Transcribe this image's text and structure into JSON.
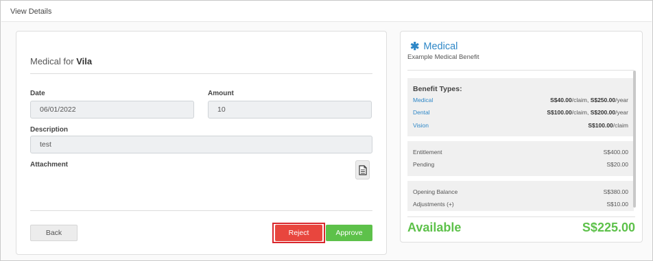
{
  "header": {
    "title": "View Details"
  },
  "form": {
    "title_prefix": "Medical for ",
    "title_name": "Vila",
    "date_label": "Date",
    "date_value": "06/01/2022",
    "amount_label": "Amount",
    "amount_value": "10",
    "description_label": "Description",
    "description_value": "test",
    "attachment_label": "Attachment",
    "attachment_icon": "document-icon"
  },
  "actions": {
    "back": "Back",
    "reject": "Reject",
    "approve": "Approve"
  },
  "benefit": {
    "icon": "asterisk-icon",
    "title": "Medical",
    "subtitle": "Example Medical Benefit",
    "types_title": "Benefit Types:",
    "types": [
      {
        "name": "Medical",
        "claim": "S$40.00",
        "claim_unit": "/claim, ",
        "year": "S$250.00",
        "year_unit": "/year"
      },
      {
        "name": "Dental",
        "claim": "S$100.00",
        "claim_unit": "/claim, ",
        "year": "S$200.00",
        "year_unit": "/year"
      },
      {
        "name": "Vision",
        "claim": "S$100.00",
        "claim_unit": "/claim"
      }
    ],
    "entitlement_label": "Entitlement",
    "entitlement_value": "S$400.00",
    "pending_label": "Pending",
    "pending_value": "S$20.00",
    "opening_label": "Opening Balance",
    "opening_value": "S$380.00",
    "adjustments_label": "Adjustments (+)",
    "adjustments_value": "S$10.00",
    "available_label": "Available",
    "available_value": "S$225.00"
  },
  "colors": {
    "link_blue": "#2e87c7",
    "reject_red": "#e8463e",
    "approve_green": "#5dc14a"
  }
}
